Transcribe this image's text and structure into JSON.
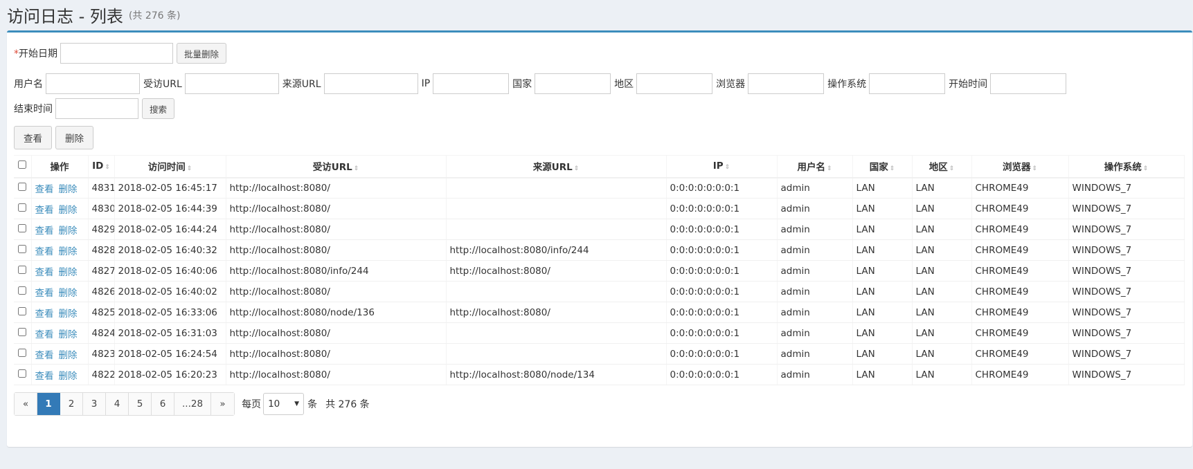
{
  "header": {
    "title": "访问日志 - 列表",
    "subtitle": "(共 276 条)"
  },
  "filters": {
    "start_date_label": "开始日期",
    "batch_delete": "批量删除",
    "fields": [
      "用户名",
      "受访URL",
      "来源URL",
      "IP",
      "国家",
      "地区",
      "浏览器",
      "操作系统",
      "开始时间"
    ],
    "end_time_label": "结束时间",
    "search": "搜索"
  },
  "actions": {
    "view": "查看",
    "delete": "删除"
  },
  "table": {
    "columns": [
      "操作",
      "ID",
      "访问时间",
      "受访URL",
      "来源URL",
      "IP",
      "用户名",
      "国家",
      "地区",
      "浏览器",
      "操作系统"
    ],
    "row_view": "查看",
    "row_delete": "删除",
    "rows": [
      [
        "4831",
        "2018-02-05 16:45:17",
        "http://localhost:8080/",
        "",
        "0:0:0:0:0:0:0:1",
        "admin",
        "LAN",
        "LAN",
        "CHROME49",
        "WINDOWS_7"
      ],
      [
        "4830",
        "2018-02-05 16:44:39",
        "http://localhost:8080/",
        "",
        "0:0:0:0:0:0:0:1",
        "admin",
        "LAN",
        "LAN",
        "CHROME49",
        "WINDOWS_7"
      ],
      [
        "4829",
        "2018-02-05 16:44:24",
        "http://localhost:8080/",
        "",
        "0:0:0:0:0:0:0:1",
        "admin",
        "LAN",
        "LAN",
        "CHROME49",
        "WINDOWS_7"
      ],
      [
        "4828",
        "2018-02-05 16:40:32",
        "http://localhost:8080/",
        "http://localhost:8080/info/244",
        "0:0:0:0:0:0:0:1",
        "admin",
        "LAN",
        "LAN",
        "CHROME49",
        "WINDOWS_7"
      ],
      [
        "4827",
        "2018-02-05 16:40:06",
        "http://localhost:8080/info/244",
        "http://localhost:8080/",
        "0:0:0:0:0:0:0:1",
        "admin",
        "LAN",
        "LAN",
        "CHROME49",
        "WINDOWS_7"
      ],
      [
        "4826",
        "2018-02-05 16:40:02",
        "http://localhost:8080/",
        "",
        "0:0:0:0:0:0:0:1",
        "admin",
        "LAN",
        "LAN",
        "CHROME49",
        "WINDOWS_7"
      ],
      [
        "4825",
        "2018-02-05 16:33:06",
        "http://localhost:8080/node/136",
        "http://localhost:8080/",
        "0:0:0:0:0:0:0:1",
        "admin",
        "LAN",
        "LAN",
        "CHROME49",
        "WINDOWS_7"
      ],
      [
        "4824",
        "2018-02-05 16:31:03",
        "http://localhost:8080/",
        "",
        "0:0:0:0:0:0:0:1",
        "admin",
        "LAN",
        "LAN",
        "CHROME49",
        "WINDOWS_7"
      ],
      [
        "4823",
        "2018-02-05 16:24:54",
        "http://localhost:8080/",
        "",
        "0:0:0:0:0:0:0:1",
        "admin",
        "LAN",
        "LAN",
        "CHROME49",
        "WINDOWS_7"
      ],
      [
        "4822",
        "2018-02-05 16:20:23",
        "http://localhost:8080/",
        "http://localhost:8080/node/134",
        "0:0:0:0:0:0:0:1",
        "admin",
        "LAN",
        "LAN",
        "CHROME49",
        "WINDOWS_7"
      ]
    ]
  },
  "pagination": {
    "pages": [
      "«",
      "1",
      "2",
      "3",
      "4",
      "5",
      "6",
      "...28",
      "»"
    ],
    "active": "1",
    "per_page_label": "每页",
    "per_page_value": "10",
    "unit": "条",
    "total": "共 276 条"
  },
  "colors": {
    "accent": "#3c8dbc",
    "active_page": "#337ab7",
    "background": "#ecf0f5"
  }
}
